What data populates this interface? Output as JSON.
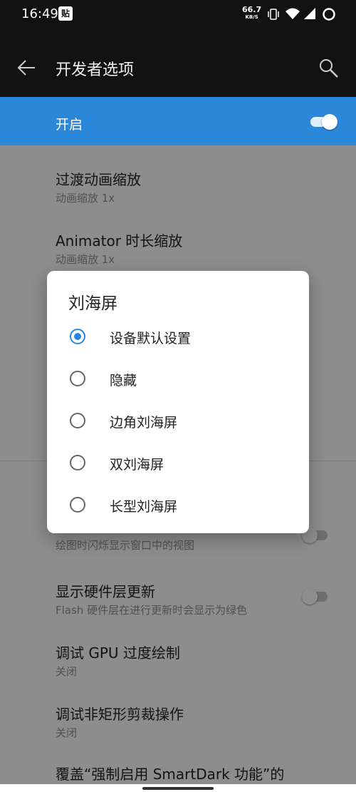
{
  "status_bar": {
    "time": "16:49",
    "notification_icon_label": "贴",
    "net_speed_value": "66.7",
    "net_speed_unit": "KB/S"
  },
  "app_bar": {
    "title": "开发者选项",
    "back_icon": "arrow-left-icon",
    "search_icon": "search-icon"
  },
  "master_switch": {
    "label": "开启",
    "enabled": true
  },
  "settings": [
    {
      "title": "过渡动画缩放",
      "subtitle": "动画缩放 1x"
    },
    {
      "title": "Animator 时长缩放",
      "subtitle": "动画缩放 1x"
    },
    {
      "title": "",
      "subtitle": "绘图时闪烁显示窗口中的视图",
      "toggle": false
    },
    {
      "title": "显示硬件层更新",
      "subtitle": "Flash 硬件层在进行更新时会显示为绿色",
      "toggle": false
    },
    {
      "title": "调试 GPU 过度绘制",
      "subtitle": "关闭"
    },
    {
      "title": "调试非矩形剪裁操作",
      "subtitle": "关闭"
    },
    {
      "title": "覆盖“强制启用 SmartDark 功能”的",
      "subtitle": ""
    }
  ],
  "dialog": {
    "title": "刘海屏",
    "selected_index": 0,
    "options": [
      "设备默认设置",
      "隐藏",
      "边角刘海屏",
      "双刘海屏",
      "长型刘海屏"
    ]
  },
  "colors": {
    "accent": "#2a86e0",
    "header_bg": "#121212",
    "switch_row_bg": "#2b88d8"
  }
}
